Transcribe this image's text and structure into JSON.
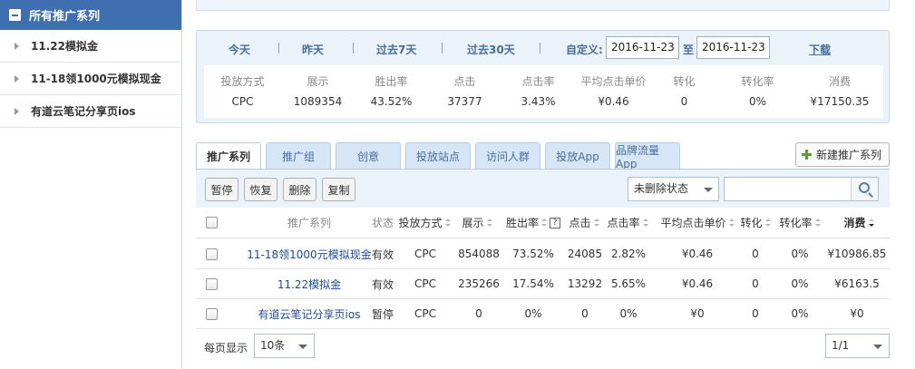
{
  "sidebar": {
    "header": "所有推广系列",
    "items": [
      {
        "label": "11.22模拟金"
      },
      {
        "label": "11-18领1000元模拟现金"
      },
      {
        "label": "有道云笔记分享页ios"
      }
    ]
  },
  "period": {
    "today": "今天",
    "yesterday": "昨天",
    "last7": "过去7天",
    "last30": "过去30天",
    "custom_label": "自定义:",
    "start_date": "2016-11-23",
    "to_label": "至",
    "end_date": "2016-11-23",
    "download": "下载"
  },
  "metrics": [
    {
      "label": "投放方式",
      "value": "CPC"
    },
    {
      "label": "展示",
      "value": "1089354"
    },
    {
      "label": "胜出率",
      "value": "43.52%"
    },
    {
      "label": "点击",
      "value": "37377"
    },
    {
      "label": "点击率",
      "value": "3.43%"
    },
    {
      "label": "平均点击单价",
      "value": "¥0.46"
    },
    {
      "label": "转化",
      "value": "0"
    },
    {
      "label": "转化率",
      "value": "0%"
    },
    {
      "label": "消费",
      "value": "¥17150.35"
    }
  ],
  "tabs": [
    "推广系列",
    "推广组",
    "创意",
    "投放站点",
    "访问人群",
    "投放App",
    "品牌流量App"
  ],
  "new_series_button": "新建推广系列",
  "toolbar": {
    "pause": "暂停",
    "resume": "恢复",
    "delete": "删除",
    "copy": "复制",
    "status_filter": "未删除状态",
    "search_value": ""
  },
  "table": {
    "headers": {
      "name": "推广系列",
      "status": "状态",
      "method": "投放方式",
      "impressions": "展示",
      "win_rate": "胜出率",
      "help": "?",
      "clicks": "点击",
      "ctr": "点击率",
      "avg_cpc": "平均点击单价",
      "conversions": "转化",
      "conv_rate": "转化率",
      "cost": "消费"
    },
    "rows": [
      {
        "name": "11-18领1000元模拟现金",
        "status": "有效",
        "method": "CPC",
        "impressions": "854088",
        "win_rate": "73.52%",
        "clicks": "24085",
        "ctr": "2.82%",
        "avg_cpc": "¥0.46",
        "conversions": "0",
        "conv_rate": "0%",
        "cost": "¥10986.85"
      },
      {
        "name": "11.22模拟金",
        "status": "有效",
        "method": "CPC",
        "impressions": "235266",
        "win_rate": "17.54%",
        "clicks": "13292",
        "ctr": "5.65%",
        "avg_cpc": "¥0.46",
        "conversions": "0",
        "conv_rate": "0%",
        "cost": "¥6163.5"
      },
      {
        "name": "有道云笔记分享页ios",
        "status": "暂停",
        "method": "CPC",
        "impressions": "0",
        "win_rate": "0%",
        "clicks": "0",
        "ctr": "0%",
        "avg_cpc": "¥0",
        "conversions": "0",
        "conv_rate": "0%",
        "cost": "¥0"
      }
    ]
  },
  "pager": {
    "per_page_label": "每页显示",
    "per_page_value": "10条",
    "page_value": "1/1"
  },
  "colors": {
    "sidebar_header": "#3f6fb0",
    "link": "#1c4b9a",
    "tab_bg": "#d6e6f6",
    "panel_bg": "#eaf2fa",
    "plus_green": "#58a12b"
  }
}
